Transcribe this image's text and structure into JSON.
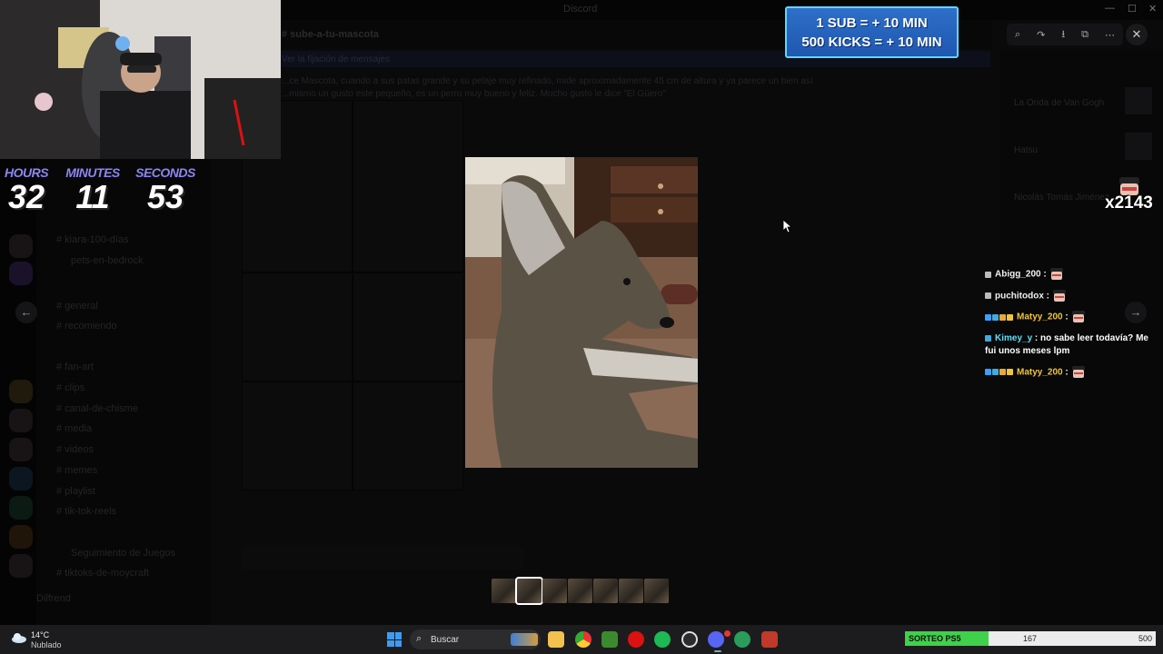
{
  "window": {
    "title": "Discord"
  },
  "background": {
    "channels": [
      "# kiara-100-días",
      "pets-en-bedrock",
      "# general",
      "# recomiendo",
      "# fan-art",
      "# clips",
      "# canal-de-chisme",
      "# media",
      "# videos",
      "# memes",
      "# playlist",
      "# tik-tok-reels",
      "Seguimiento de Juegos",
      "# tiktoks-de-moycraft"
    ],
    "channel_header": "# sube-a-tu-mascota",
    "pinned_banner": "Ver la fijación de mensajes",
    "message_lines": [
      "...ce Mascota, cuando a sus patas grande y su pelaje muy refinado, mide aproximadamente 45 cm de altura y ya parece un bien así",
      "...mismo un gusto este pequeño, es un perro muy bueno y feliz. Mucho gusto le dice \"El Güero\""
    ],
    "members": [
      "La Onda de Van Gogh",
      "Hatsu",
      "Nicolás Tomás Jiménez"
    ],
    "user_name": "Dilfrend"
  },
  "viewer": {
    "tools": [
      "zoom-icon",
      "forward-icon",
      "download-icon",
      "open-external-icon",
      "more-icon"
    ],
    "close": "✕",
    "prev": "←",
    "next": "→",
    "thumbnail_count": 7,
    "active_thumb": 1
  },
  "timer": {
    "hours_label": "HOURS",
    "hours": "32",
    "minutes_label": "MINUTES",
    "minutes": "11",
    "seconds_label": "SECONDS",
    "seconds": "53"
  },
  "sub_banner": {
    "line1": "1 SUB = + 10 MIN",
    "line2": "500 KICKS = + 10 MIN"
  },
  "emote_counter": {
    "count": "x2143"
  },
  "chat": [
    {
      "user": "Abigg_200",
      "sep": " :",
      "text": "",
      "color": "white",
      "badges": 1
    },
    {
      "user": "puchitodox",
      "sep": " :",
      "text": "",
      "color": "white",
      "badges": 1
    },
    {
      "user": "Matyy_200",
      "sep": " :",
      "text": "",
      "color": "gold",
      "badges": 4
    },
    {
      "user": "Kimey_y",
      "sep": " :",
      "text": "no sabe leer todavía? Me fui unos meses lpm",
      "color": "cyan",
      "badges": 1
    },
    {
      "user": "Matyy_200",
      "sep": " :",
      "text": "",
      "color": "gold",
      "badges": 4
    }
  ],
  "taskbar": {
    "weather_temp": "14°C",
    "weather_desc": "Nublado",
    "search_placeholder": "Buscar"
  },
  "sorteo": {
    "label": "SORTEO PS5",
    "current": "167",
    "goal": "500",
    "fraction": 0.334,
    "color": "#3fd14a"
  }
}
